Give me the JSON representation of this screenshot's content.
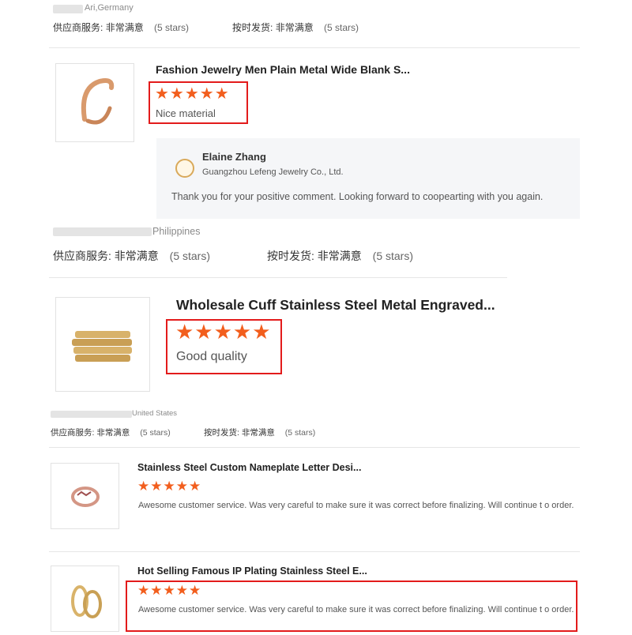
{
  "colors": {
    "star": "#f25e1d",
    "highlight": "#e31b1b",
    "reply_bg": "#f5f6f8"
  },
  "icons": {
    "star": "star-icon",
    "avatar": "supplier-avatar-icon"
  },
  "labels": {
    "supplier_service": "供应商服务:",
    "on_time_delivery": "按时发货:",
    "very_satisfied": "非常满意",
    "five_stars": "(5 stars)"
  },
  "reviews": [
    {
      "country": "Ari,Germany"
    },
    {
      "product_title": "Fashion Jewelry Men Plain Metal Wide Blank S...",
      "rating": 5,
      "stars": "★★★★★",
      "comment": "Nice material",
      "reply": {
        "name": "Elaine Zhang",
        "company": "Guangzhou Lefeng Jewelry Co., Ltd.",
        "text": "Thank you for your positive comment. Looking forward to coopearting with you again."
      },
      "country": "Philippines"
    },
    {
      "product_title": "Wholesale Cuff Stainless Steel Metal Engraved...",
      "rating": 5,
      "stars": "★★★★★",
      "comment": "Good quality",
      "country": "United States"
    },
    {
      "product_title": "Stainless Steel Custom Nameplate Letter Desi...",
      "rating": 5,
      "stars": "★★★★★",
      "comment": "Awesome customer service.  Was very careful to make sure it was correct before finalizing.  Will continue t o order."
    },
    {
      "product_title": "Hot Selling Famous IP Plating Stainless Steel E...",
      "rating": 5,
      "stars": "★★★★★",
      "comment": "Awesome customer service.  Was very careful to make sure it was correct before finalizing.  Will continue t o order."
    }
  ]
}
